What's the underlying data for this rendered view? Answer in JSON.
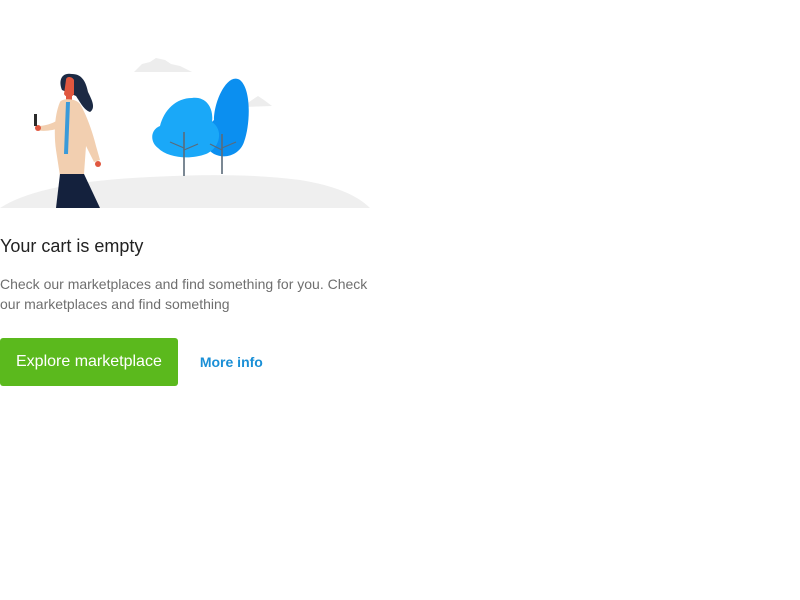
{
  "empty_state": {
    "illustration": "woman-with-phone-and-trees-illustration",
    "title": "Your cart is empty",
    "description": "Check our marketplaces and find something for you. Check our marketplaces and find something",
    "primary_button_label": "Explore marketplace",
    "secondary_link_label": "More info"
  },
  "colors": {
    "primary": "#5bb91d",
    "link": "#1a8fd6",
    "title": "#222222",
    "description": "#6f6f6f",
    "tree": "#0b8ff0"
  }
}
